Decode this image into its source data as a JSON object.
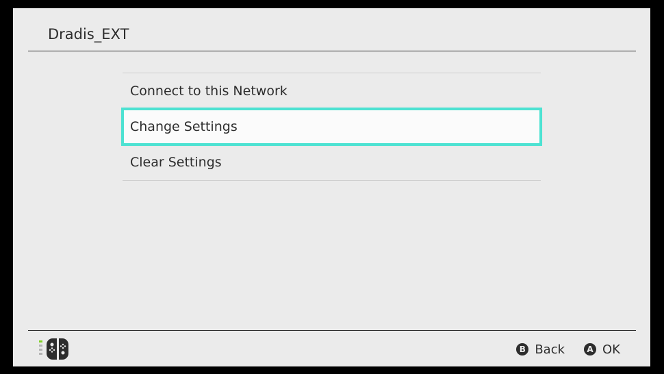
{
  "header": {
    "title": "Dradis_EXT"
  },
  "menu": {
    "items": [
      {
        "label": "Connect to this Network",
        "selected": false
      },
      {
        "label": "Change Settings",
        "selected": true
      },
      {
        "label": "Clear Settings",
        "selected": false
      }
    ]
  },
  "footer": {
    "controller_icon": "joycon-controller-icon",
    "hints": [
      {
        "glyph": "B",
        "label": "Back"
      },
      {
        "glyph": "A",
        "label": "OK"
      }
    ]
  },
  "colors": {
    "background": "#ebebeb",
    "selection_border": "#4de2d2",
    "text": "#2d2d2d"
  }
}
